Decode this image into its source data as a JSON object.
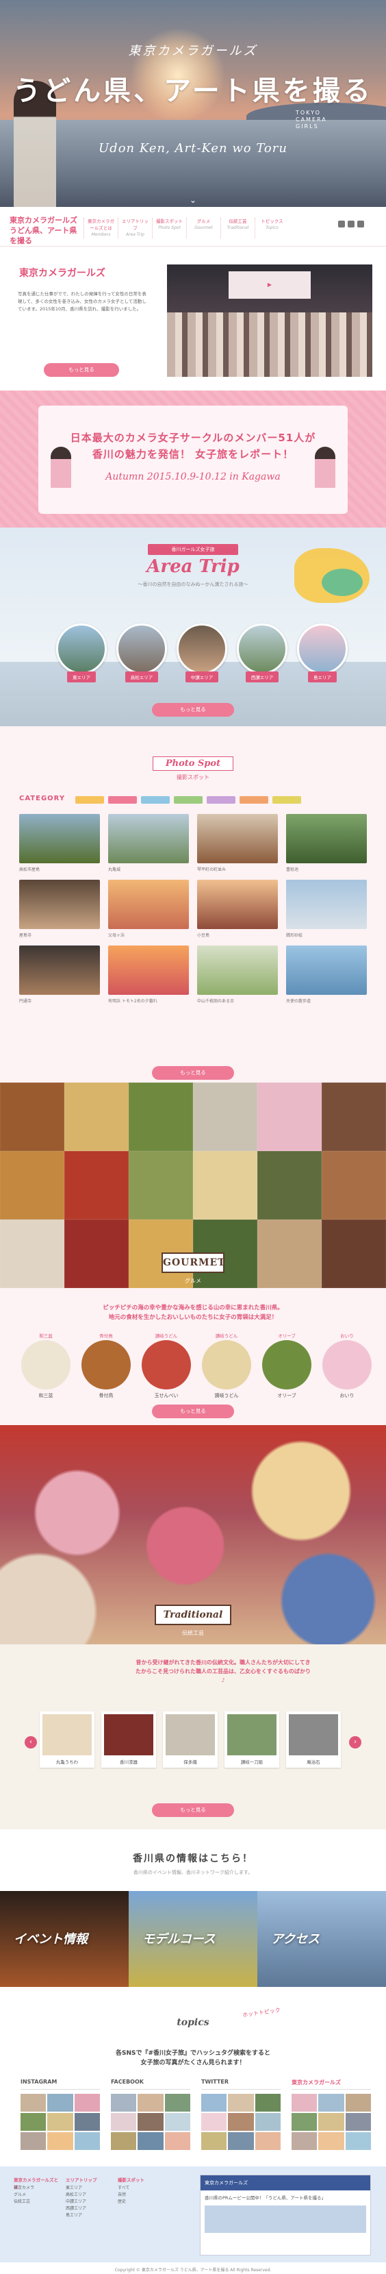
{
  "hero": {
    "sub": "東京カメラガールズ",
    "title": "うどん県、アート県を撮る",
    "tokyo": "TOKYO CAMERA GIRLS",
    "roman": "Udon Ken, Art-Ken wo Toru"
  },
  "nav": {
    "logo": "東京カメラガールズ うどん県、アート県を撮る",
    "items": [
      {
        "jp": "東京カメラガールズとは",
        "en": "Members"
      },
      {
        "jp": "エリアトリップ",
        "en": "Area Trip"
      },
      {
        "jp": "撮影スポット",
        "en": "Photo Spot"
      },
      {
        "jp": "グルメ",
        "en": "Gourmet"
      },
      {
        "jp": "伝統工芸",
        "en": "Traditional"
      },
      {
        "jp": "トピックス",
        "en": "Topics"
      }
    ]
  },
  "about": {
    "logo": "東京カメラガールズ",
    "text": "写真を通じた仕事がでで、わたしの発揮を行って女性の日常を表現して、多くの女性を巻き込み、女性のカメラ女子として活動しています。2015年10月、香川県を訪れ、撮影を行いました。",
    "button": "もっと見る"
  },
  "members": {
    "line1": "日本最大のカメラ女子サークルのメンバー51人が",
    "line2": "香川の魅力を発信！ 女子旅をレポート！",
    "date": "Autumn 2015.10.9-10.12 in Kagawa"
  },
  "area": {
    "label": "香川ガールズ女子旅",
    "title": "Area Trip",
    "sub": "〜香川の自然を自由のなみぬーかん満たされる旅〜",
    "items": [
      "東エリア",
      "高松エリア",
      "中讃エリア",
      "西讃エリア",
      "島エリア"
    ],
    "button": "もっと見る"
  },
  "spot": {
    "title_en": "Photo Spot",
    "title_jp": "撮影スポット",
    "category": "CATEGORY",
    "items": [
      "高松市屋島",
      "丸亀城",
      "琴平町の町並み",
      "豊稔池",
      "屋島寺",
      "父母ヶ浜",
      "小豆島",
      "銭形砂絵",
      "円通寺",
      "有明浜 トモト2名の夕暮れ",
      "中山千枚田のある日",
      "天使の散歩道"
    ],
    "button": "もっと見る"
  },
  "gourmet": {
    "badge": "GOURMET",
    "jp": "グルメ",
    "desc1": "ピッチピチの海の幸や豊かな海みを感じる山の幸に恵まれた香川県。",
    "desc2": "地元の食材を生かしたおいしいものたちに女子の胃袋は大満足！",
    "items": [
      {
        "label": "和三盆",
        "title": "和三盆"
      },
      {
        "label": "骨付鳥",
        "title": "骨付鳥"
      },
      {
        "label": "讃岐うどん",
        "title": "玉せんべい"
      },
      {
        "label": "讃岐うどん",
        "title": "讃岐うどん"
      },
      {
        "label": "オリーブ",
        "title": "オリーブ"
      },
      {
        "label": "おいり",
        "title": "おいり"
      }
    ],
    "button": "もっと見る"
  },
  "trad": {
    "badge": "Traditional",
    "jp": "伝統工芸",
    "desc": "昔から受け継がれてきた香川の伝統文化。職人さんたちが大切にしてきたからこそ見つけられた職人の工芸品は、乙女心をくすぐるものばかり♪",
    "items": [
      "丸亀うちわ",
      "香川漆器",
      "保多織",
      "讃岐一刀彫",
      "庵治石",
      "讃岐のり染"
    ],
    "button": "もっと見る"
  },
  "info": {
    "head": "香川県の情報はこちら！",
    "sub": "香川県のイベント情報、香川ネットワーク紹介します。",
    "cards": [
      "イベント情報",
      "モデルコース",
      "アクセス"
    ]
  },
  "topics": {
    "badge": "topics",
    "right": "ホットトピック",
    "msg1": "各SNSで『#香川女子旅』でハッシュタグ検索をすると",
    "msg2": "女子旅の写真がたくさん見られます！"
  },
  "sns": {
    "cols": [
      "INSTAGRAM",
      "FACEBOOK",
      "TWITTER",
      "東京カメラガールズ"
    ]
  },
  "footer": {
    "cols": [
      {
        "head": "東京カメラガールズとは",
        "items": [
          "東京カメラ",
          "グルメ",
          "伝統工芸"
        ]
      },
      {
        "head": "エリアトリップ",
        "items": [
          "東エリア",
          "高松エリア",
          "中讃エリア",
          "西讃エリア",
          "島エリア"
        ]
      },
      {
        "head": "撮影スポット",
        "items": [
          "すべて",
          "自然",
          "歴史"
        ]
      }
    ],
    "fb_header": "東京カメラガールズ",
    "fb_post": "香川県のPRムービー公開中！「うどん県、アート県を撮る」",
    "copy": "Copyright © 東京カメラガールズ うどん県、アート県を撮る All Rights Reserved."
  }
}
